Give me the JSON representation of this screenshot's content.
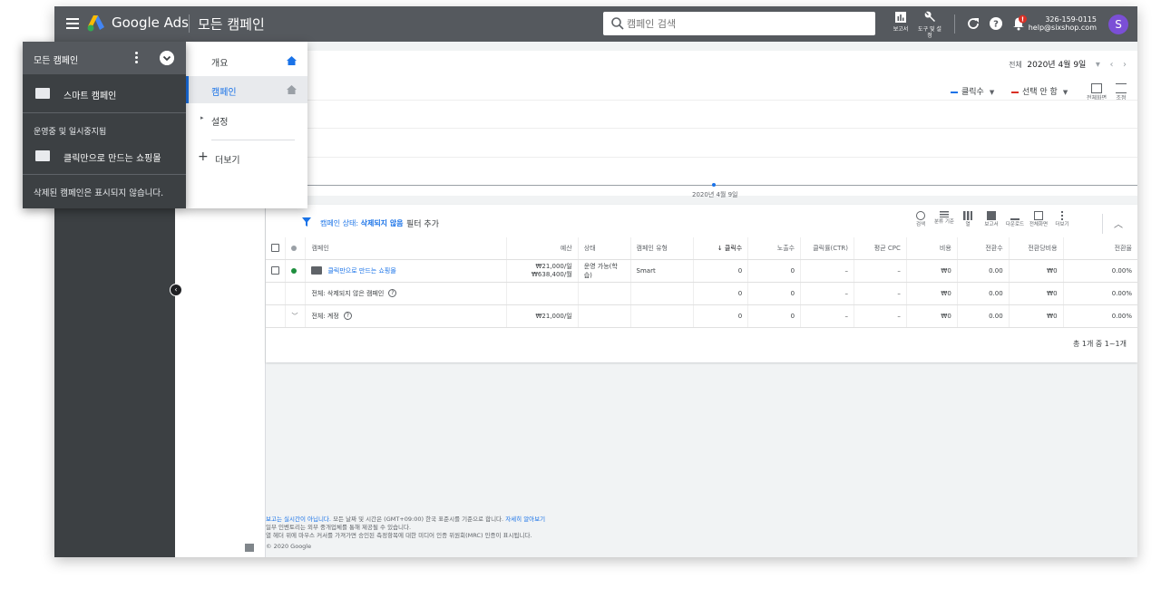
{
  "topbar": {
    "brand": "Google Ads",
    "page_title": "모든 캠페인",
    "search_placeholder": "캠페인 검색",
    "tools": [
      {
        "label": "보고서",
        "icon": "reports-icon"
      },
      {
        "label": "도구 및 설정",
        "icon": "wrench-icon"
      }
    ],
    "account_id": "326-159-0115",
    "account_email": "help@sixshop.com",
    "avatar_letter": "S"
  },
  "campaign_menu": {
    "header": "모든 캠페인",
    "smart_item": "스마트 캠페인",
    "section_label": "운영중 및 일시중지됨",
    "campaign_item": "클릭만으로 만드는 쇼핑몰",
    "footer": "삭제된 캠페인은 표시되지 않습니다."
  },
  "page_nav": {
    "items": [
      {
        "label": "개요"
      },
      {
        "label": "캠페인"
      },
      {
        "label": "설정"
      }
    ],
    "more": "더보기"
  },
  "chart_card": {
    "range_label": "전체",
    "date": "2020년 4월 9일",
    "metric1": "클릭수",
    "metric2": "선택 안 함",
    "tool_fullscreen": "전체화면",
    "tool_adjust": "조정",
    "x_label": "2020년 4월 9일",
    "colors": {
      "metric1": "#1a73e8",
      "metric2": "#d93025"
    }
  },
  "table": {
    "filter_prefix": "캠페인 상태:",
    "filter_value": "삭제되지 않음",
    "filter_add": "필터 추가",
    "tools": [
      "검색",
      "분류 기준",
      "열",
      "보고서",
      "다운로드",
      "전체화면",
      "더보기"
    ],
    "headers": [
      "캠페인",
      "예산",
      "상태",
      "캠페인 유형",
      "클릭수",
      "노출수",
      "클릭률(CTR)",
      "평균 CPC",
      "비용",
      "전환수",
      "전환당비용",
      "전환율"
    ],
    "sort_arrow": "↓",
    "row1": {
      "name": "클릭만으로 만드는 쇼핑몰",
      "budget1": "₩21,000/일",
      "budget2": "₩638,400/월",
      "status": "운영 가능(학습)",
      "type": "Smart",
      "clicks": "0",
      "impr": "0",
      "ctr": "–",
      "cpc": "–",
      "cost": "₩0",
      "conv": "0.00",
      "cpa": "₩0",
      "rate": "0.00%"
    },
    "row2": {
      "name": "전체: 삭제되지 않은 캠페인",
      "clicks": "0",
      "impr": "0",
      "ctr": "–",
      "cpc": "–",
      "cost": "₩0",
      "conv": "0.00",
      "cpa": "₩0",
      "rate": "0.00%"
    },
    "row3": {
      "name": "전체: 계정",
      "budget1": "₩21,000/일",
      "clicks": "0",
      "impr": "0",
      "ctr": "–",
      "cpc": "–",
      "cost": "₩0",
      "conv": "0.00",
      "cpa": "₩0",
      "rate": "0.00%"
    },
    "pagination": "총 1개 중 1~1개",
    "status_color": "#1e8e3e"
  },
  "notes": {
    "line1_link": "보고는 실시간이 아닙니다.",
    "line1_text": "모든 날짜 및 시간은 (GMT+09:00) 한국 표준시를 기준으로 합니다.",
    "line1_link2": "자세히 알아보기",
    "line2": "일부 인벤토리는 외부 중개업체를 통해 제공될 수 있습니다.",
    "line3": "열 헤더 위에 마우스 커서를 가져가면 승인된 측정항목에 대한 미디어 인증 위원회(MRC) 인증이 표시됩니다.",
    "copyright": "© 2020 Google"
  }
}
